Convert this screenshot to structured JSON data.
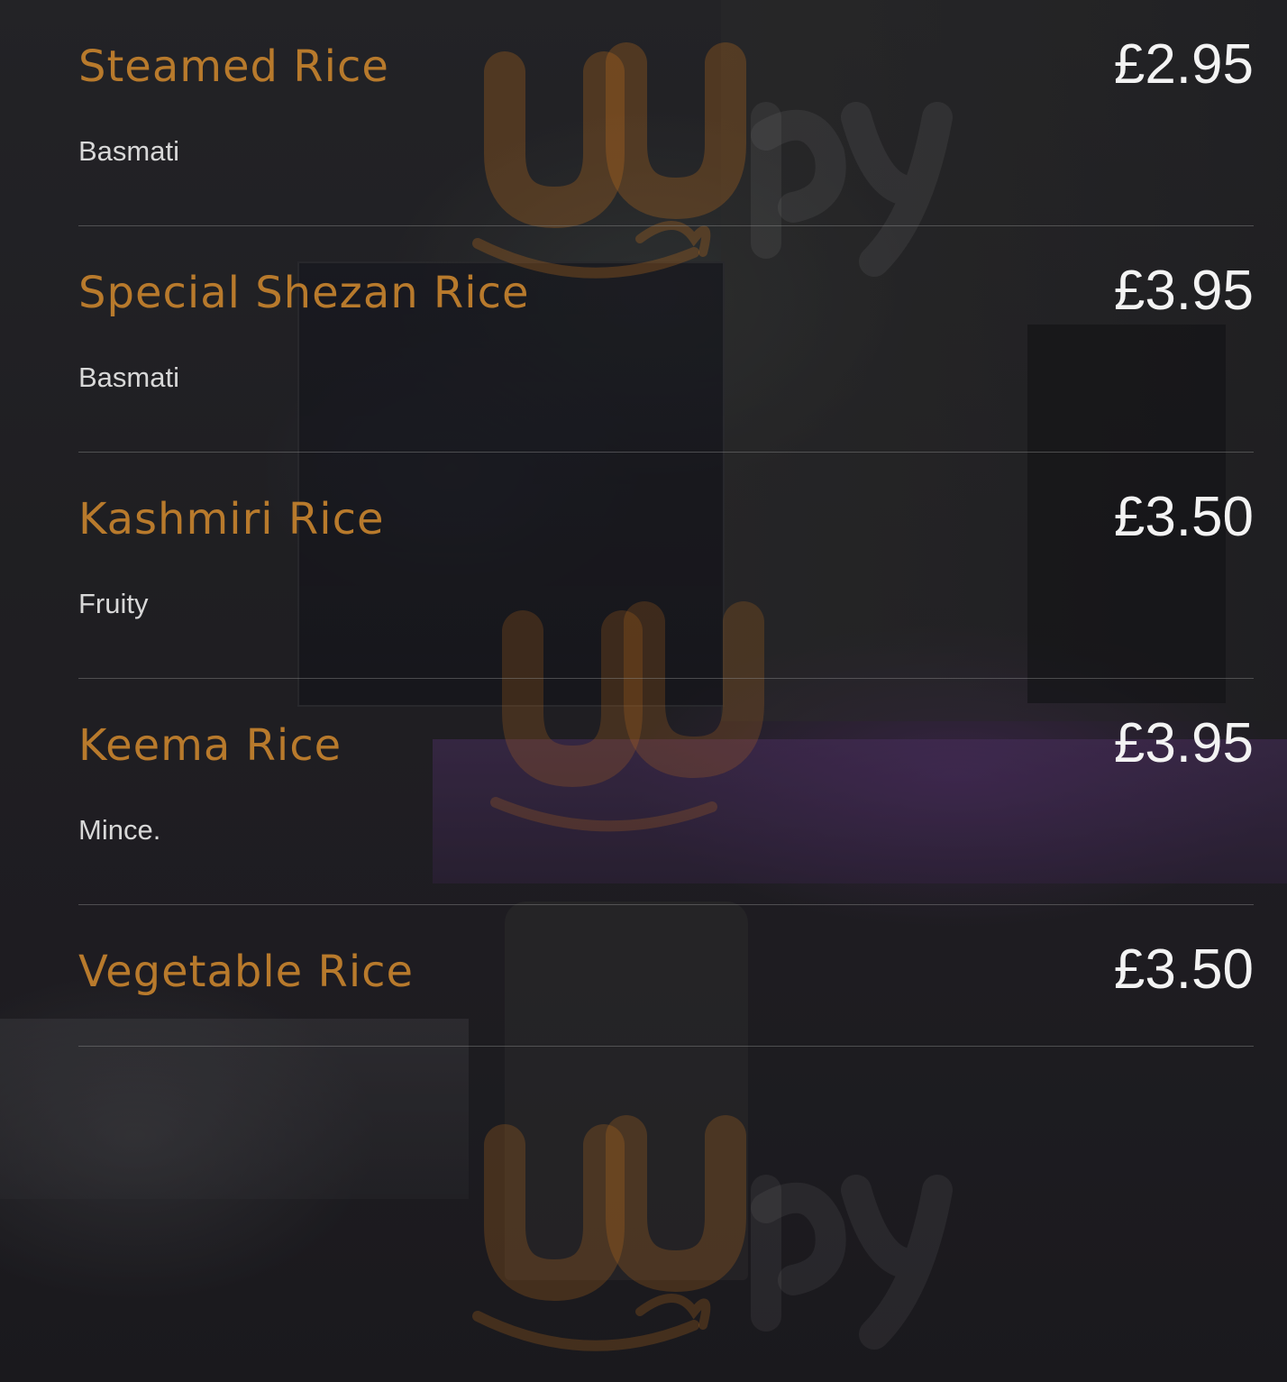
{
  "colors": {
    "item_name": "#b87a2c",
    "price": "#f3f3f3",
    "description": "#d8d8d8",
    "divider": "#8c8c8c",
    "watermark": "#c8731c"
  },
  "watermark": {
    "icon": "tripadvisor-style-logo-watermark"
  },
  "menu": {
    "items": [
      {
        "name": "Steamed Rice",
        "price": "£2.95",
        "description": "Basmati"
      },
      {
        "name": "Special Shezan Rice",
        "price": "£3.95",
        "description": "Basmati"
      },
      {
        "name": "Kashmiri Rice",
        "price": "£3.50",
        "description": "Fruity"
      },
      {
        "name": "Keema Rice",
        "price": "£3.95",
        "description": "Mince."
      },
      {
        "name": "Vegetable Rice",
        "price": "£3.50"
      }
    ]
  }
}
